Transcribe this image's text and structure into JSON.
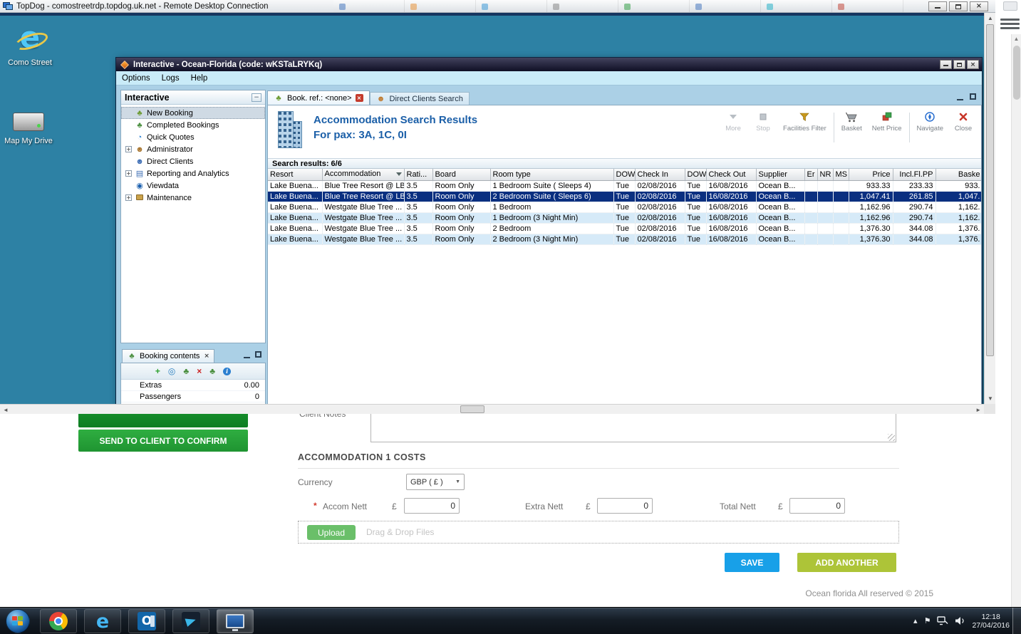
{
  "rdp": {
    "title": "TopDog - comostreetrdp.topdog.uk.net - Remote Desktop Connection"
  },
  "desktop": {
    "icons": [
      {
        "label": "Como Street",
        "icon": "internet-explorer-icon"
      },
      {
        "label": "Map My Drive",
        "icon": "drive-icon"
      }
    ]
  },
  "app": {
    "title": "Interactive - Ocean-Florida (code: wKSTaLRYKq)",
    "menu": [
      "Options",
      "Logs",
      "Help"
    ],
    "sidebar": {
      "title": "Interactive",
      "items": [
        {
          "label": "New Booking",
          "icon": "palm-icon",
          "selected": true
        },
        {
          "label": "Completed Bookings",
          "icon": "palm-check-icon"
        },
        {
          "label": "Quick Quotes",
          "icon": "clock-icon"
        },
        {
          "label": "Administrator",
          "icon": "administrator-icon",
          "expandable": true
        },
        {
          "label": "Direct Clients",
          "icon": "clients-icon"
        },
        {
          "label": "Reporting and Analytics",
          "icon": "report-icon",
          "expandable": true
        },
        {
          "label": "Viewdata",
          "icon": "viewdata-icon"
        },
        {
          "label": "Maintenance",
          "icon": "maintenance-icon",
          "expandable": true
        }
      ]
    },
    "tabs": [
      {
        "label": "Book. ref.: <none>",
        "icon": "palm-icon",
        "active": true,
        "closable": true
      },
      {
        "label": "Direct Clients Search",
        "icon": "person-icon",
        "active": false
      }
    ],
    "results": {
      "title": "Accommodation Search Results",
      "subtitle": "For pax: 3A, 1C, 0I",
      "summary": "Search results: 6/6",
      "toolbar": [
        {
          "label": "More",
          "icon": "more-icon",
          "disabled": true
        },
        {
          "label": "Stop",
          "icon": "stop-icon",
          "disabled": true
        },
        {
          "label": "Facilities Filter",
          "icon": "filter-icon"
        },
        {
          "label": "Basket",
          "icon": "basket-icon"
        },
        {
          "label": "Nett Price",
          "icon": "nett-price-icon"
        },
        {
          "label": "Navigate",
          "icon": "navigate-icon"
        },
        {
          "label": "Close",
          "icon": "close-icon"
        }
      ],
      "table": {
        "columns": [
          "Resort",
          "Accommodation",
          "Rati...",
          "Board",
          "Room type",
          "DOW",
          "Check In",
          "DOW",
          "Check Out",
          "Supplier",
          "Er",
          "NR",
          "MS",
          "Price",
          "Incl.Fl.PP",
          "Baske"
        ],
        "selected_row_index": 1,
        "rows": [
          [
            "Lake Buena...",
            "Blue Tree Resort @ LBV",
            "3.5",
            "Room Only",
            "1 Bedroom Suite ( Sleeps 4)",
            "Tue",
            "02/08/2016",
            "Tue",
            "16/08/2016",
            "Ocean B...",
            "",
            "",
            "",
            "933.33",
            "233.33",
            "933."
          ],
          [
            "Lake Buena...",
            "Blue Tree Resort @ LBV",
            "3.5",
            "Room Only",
            "2 Bedroom Suite ( Sleeps 6)",
            "Tue",
            "02/08/2016",
            "Tue",
            "16/08/2016",
            "Ocean B...",
            "",
            "",
            "",
            "1,047.41",
            "261.85",
            "1,047."
          ],
          [
            "Lake Buena...",
            "Westgate Blue Tree ...",
            "3.5",
            "Room Only",
            "1 Bedroom",
            "Tue",
            "02/08/2016",
            "Tue",
            "16/08/2016",
            "Ocean B...",
            "",
            "",
            "",
            "1,162.96",
            "290.74",
            "1,162."
          ],
          [
            "Lake Buena...",
            "Westgate Blue Tree ...",
            "3.5",
            "Room Only",
            "1 Bedroom (3 Night Min)",
            "Tue",
            "02/08/2016",
            "Tue",
            "16/08/2016",
            "Ocean B...",
            "",
            "",
            "",
            "1,162.96",
            "290.74",
            "1,162."
          ],
          [
            "Lake Buena...",
            "Westgate Blue Tree ...",
            "3.5",
            "Room Only",
            "2 Bedroom",
            "Tue",
            "02/08/2016",
            "Tue",
            "16/08/2016",
            "Ocean B...",
            "",
            "",
            "",
            "1,376.30",
            "344.08",
            "1,376."
          ],
          [
            "Lake Buena...",
            "Westgate Blue Tree ...",
            "3.5",
            "Room Only",
            "2 Bedroom (3 Night Min)",
            "Tue",
            "02/08/2016",
            "Tue",
            "16/08/2016",
            "Ocean B...",
            "",
            "",
            "",
            "1,376.30",
            "344.08",
            "1,376."
          ]
        ]
      }
    },
    "booking_contents": {
      "title": "Booking contents",
      "toolbar_icons": [
        "add-icon",
        "globe-icon",
        "palm-plus-icon",
        "delete-icon",
        "palm-icon",
        "info-icon"
      ],
      "rows": [
        {
          "label": "Extras",
          "value": "0.00"
        },
        {
          "label": "Passengers",
          "value": "0"
        }
      ]
    }
  },
  "page": {
    "send_button": "SEND TO CLIENT TO CONFIRM",
    "client_notes": "Client Notes",
    "costs_title": "ACCOMMODATION 1 COSTS",
    "currency_label": "Currency",
    "currency_value": "GBP ( £ )",
    "required_mark": "*",
    "accom_nett": {
      "label": "Accom Nett",
      "symbol": "£",
      "value": "0"
    },
    "extra_nett": {
      "label": "Extra Nett",
      "symbol": "£",
      "value": "0"
    },
    "total_nett": {
      "label": "Total Nett",
      "symbol": "£",
      "value": "0"
    },
    "upload_button": "Upload",
    "dragdrop": "Drag & Drop Files",
    "save_button": "SAVE",
    "add_button": "ADD ANOTHER",
    "footer": "Ocean florida All reserved © 2015"
  },
  "taskbar": {
    "time": "12:18",
    "date": "27/04/2016"
  }
}
